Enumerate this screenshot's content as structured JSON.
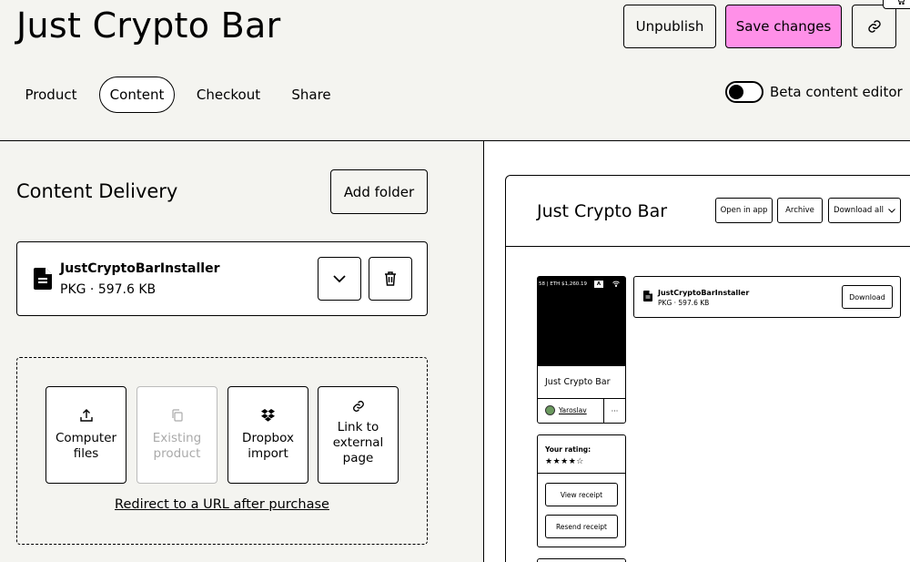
{
  "header": {
    "title": "Just Crypto Bar",
    "unpublish_label": "Unpublish",
    "save_label": "Save changes",
    "accent_color": "#ff90e8"
  },
  "tabs": [
    {
      "label": "Product",
      "active": false
    },
    {
      "label": "Content",
      "active": true
    },
    {
      "label": "Checkout",
      "active": false
    },
    {
      "label": "Share",
      "active": false
    }
  ],
  "beta_toggle": {
    "label": "Beta content editor",
    "on": false
  },
  "content": {
    "section_title": "Content Delivery",
    "add_folder_label": "Add folder",
    "file": {
      "name": "JustCryptoBarInstaller",
      "meta": "PKG · 597.6 KB"
    },
    "upload_options": [
      {
        "label": "Computer files",
        "icon": "upload-icon",
        "disabled": false
      },
      {
        "label": "Existing product",
        "icon": "copy-icon",
        "disabled": true
      },
      {
        "label": "Dropbox import",
        "icon": "dropbox-icon",
        "disabled": false
      },
      {
        "label": "Link to external page",
        "icon": "link-icon",
        "disabled": false
      }
    ],
    "redirect_label": "Redirect to a URL after purchase"
  },
  "preview": {
    "title": "Just Crypto Bar",
    "open_in_app": "Open in app",
    "archive": "Archive",
    "download_all": "Download all",
    "file": {
      "name": "JustCryptoBarInstaller",
      "meta": "PKG · 597.6 KB",
      "download": "Download"
    },
    "product": {
      "status_text": "58 | ETH $1,260.19",
      "status_badge": "A",
      "name": "Just Crypto Bar",
      "seller": "Yaroslav",
      "more": "···"
    },
    "rating": {
      "label": "Your rating:",
      "stars": "★★★★☆",
      "value": 4
    },
    "view_receipt": "View receipt",
    "resend_receipt": "Resend receipt"
  }
}
